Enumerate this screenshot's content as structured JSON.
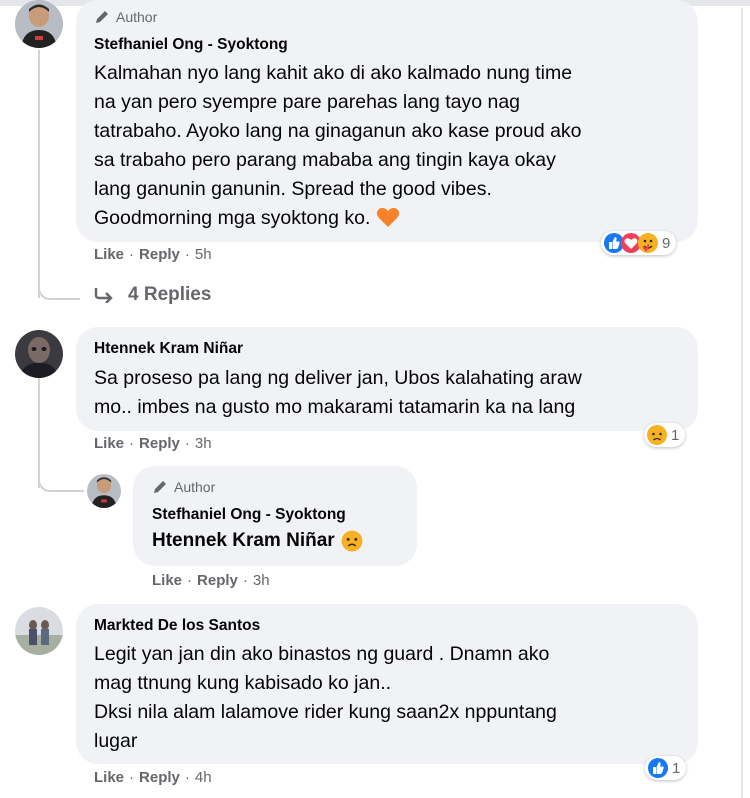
{
  "comments": [
    {
      "author_badge": "Author",
      "name": "Stefhaniel Ong - Syoktong",
      "text": "Kalmahan nyo lang kahit ako di ako kalmado nung time\nna yan pero syempre pare parehas lang tayo nag\ntatrabaho. Ayoko lang na ginaganun ako kase proud ako\nsa trabaho pero parang mababa ang tingin kaya okay\nlang ganunin ganunin. Spread the good vibes.\nGoodmorning mga syoktong ko.",
      "emoji": "orange-heart",
      "like": "Like",
      "reply": "Reply",
      "time": "5h",
      "reaction_icons": [
        "like",
        "love",
        "care"
      ],
      "reaction_count": "9",
      "view_replies": "4 Replies"
    },
    {
      "name": "Htennek Kram Niñar",
      "text": "Sa proseso pa lang ng deliver jan, Ubos kalahating araw\nmo.. imbes na gusto mo makarami tatamarin ka na lang",
      "like": "Like",
      "reply": "Reply",
      "time": "3h",
      "reaction_icons": [
        "sad"
      ],
      "reaction_count": "1",
      "reply_comment": {
        "author_badge": "Author",
        "name": "Stefhaniel Ong - Syoktong",
        "mention": "Htennek Kram Niñar",
        "emoji": "sad-face",
        "like": "Like",
        "reply": "Reply",
        "time": "3h"
      }
    },
    {
      "name": "Markted De los Santos",
      "text": "Legit yan jan din ako binastos ng guard . Dnamn ako\nmag ttnung kung kabisado ko jan..\nDksi nila alam lalamove rider kung saan2x nppuntang\nlugar",
      "like": "Like",
      "reply": "Reply",
      "time": "4h",
      "reaction_icons": [
        "like"
      ],
      "reaction_count": "1"
    }
  ],
  "colors": {
    "bubble": "#f0f2f5",
    "secondary_text": "#65676b",
    "like_blue": "#1877f2",
    "love_red": "#f33e58",
    "emoji_yellow": "#f7b125",
    "heart_orange": "#f7822a"
  }
}
